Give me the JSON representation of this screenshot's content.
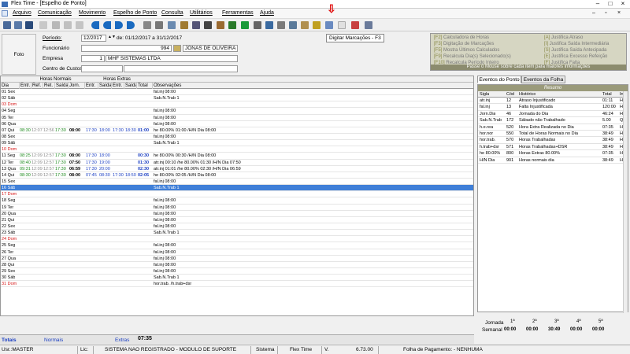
{
  "window": {
    "title": "Flex Time - [Espelho de Ponto]"
  },
  "menu": [
    "Arquivo",
    "Comunicação",
    "Movimento",
    "Espelho de Ponto",
    "Consulta",
    "Utilitários",
    "Ferramentas",
    "Ajuda"
  ],
  "tooltip": "Digitar Marcações - F3",
  "header": {
    "foto": "Foto",
    "periodo_label": "Período:",
    "periodo_value": "12/2017",
    "periodo_range": "de: 01/12/2017 a 31/12/2017",
    "funcionario_label": "Funcionário",
    "funcionario_id": "994",
    "funcionario_name": "JONAS DE OLIVEIRA",
    "empresa_label": "Empresa",
    "empresa_id": "1",
    "empresa_name": "MHF SISTEMAS LTDA",
    "centro_label": "Centro de Custos"
  },
  "legend": {
    "left": [
      {
        "k": "[F2]",
        "t": "Calculadora de Horas"
      },
      {
        "k": "[F3]",
        "t": "Digitação de Marcações"
      },
      {
        "k": "[F5]",
        "t": "Mostra Últimos Calculados"
      },
      {
        "k": "[F9]",
        "t": "Recalcula Dia(s) Selecionado(s)"
      },
      {
        "k": "[F10]",
        "t": "Recalcula Período Inteiro"
      }
    ],
    "right": [
      {
        "k": "[A]",
        "t": "Justifica Atraso"
      },
      {
        "k": "[I]",
        "t": "Justifica Saída Intermediária"
      },
      {
        "k": "[S]",
        "t": "Justifica Saída Antecipada"
      },
      {
        "k": "[E]",
        "t": "Justifica Excesso Refeição"
      },
      {
        "k": "[F]",
        "t": "Justifica Falta"
      }
    ],
    "note": "Passe o Mouse sobre cada item para maiores informações"
  },
  "grid": {
    "group_normais": "Horas Normais",
    "group_extras": "Horas Extras",
    "headers": [
      "Dia",
      "Entr.",
      "Ref.",
      "Ret.",
      "Saída",
      "Jorn.",
      "Entr.",
      "Saída",
      "Entr.",
      "Saída",
      "Total",
      "Observações"
    ],
    "rows": [
      {
        "dia": "01 Sex",
        "obs": "fal.inj 08:00"
      },
      {
        "dia": "02 Sáb",
        "obs": "Sab.N.Trab 1"
      },
      {
        "dia": "03 Dom",
        "red": true
      },
      {
        "dia": "04 Seg",
        "obs": "fal.inj 08:00"
      },
      {
        "dia": "05 Ter",
        "obs": "fal.inj 08:00"
      },
      {
        "dia": "06 Qua",
        "obs": "fal.inj 08:00"
      },
      {
        "dia": "07 Qui",
        "e1": "08:30",
        "r1": "12:07",
        "r2": "12:56",
        "s1": "17:30",
        "jor": "08:00",
        "xe1": "17:30",
        "xs1": "18:00",
        "xe2": "17:30",
        "xs2": "18:30",
        "tot": "01:00",
        "obs": "he 80.00% 01:00 /H/N Dia 08:00"
      },
      {
        "dia": "08 Sex",
        "obs": "fal.inj 08:00"
      },
      {
        "dia": "09 Sáb",
        "obs": "Sab.N.Trab 1"
      },
      {
        "dia": "10 Dom",
        "red": true
      },
      {
        "dia": "11 Seg",
        "e1": "08:25",
        "r1": "12:09",
        "r2": "12:57",
        "s1": "17:30",
        "jor": "08:00",
        "xe1": "17:30",
        "xs1": "18:00",
        "tot": "00:30",
        "obs": "he 80.00% 00:30 /H/N Dia 08:00"
      },
      {
        "dia": "12 Ter",
        "e1": "08:40",
        "r1": "12:09",
        "r2": "12:57",
        "s1": "17:30",
        "jor": "07:50",
        "xe1": "17:30",
        "xs1": "19:00",
        "tot": "01:30",
        "obs": "atr.inj 00:10 /he 80.00% 01:30 /H/N Dia 07:50"
      },
      {
        "dia": "13 Qua",
        "e1": "09:31",
        "r1": "12:09",
        "r2": "12:57",
        "s1": "17:30",
        "jor": "06:59",
        "xe1": "17:30",
        "xs1": "20:00",
        "tot": "02:30",
        "obs": "atr.inj 01:01 /he 80.00% 02:30 /H/N Dia 06:59"
      },
      {
        "dia": "14 Qui",
        "e1": "08:30",
        "r1": "12:09",
        "r2": "12:57",
        "s1": "17:30",
        "jor": "08:00",
        "xe1": "07:45",
        "xs1": "08:30",
        "xe2": "17:30",
        "xs2": "18:50",
        "tot": "02:05",
        "obs": "he 80.00% 02:05 /H/N Dia 08:00"
      },
      {
        "dia": "15 Sex",
        "obs": "fal.inj 08:00"
      },
      {
        "dia": "16 Sáb",
        "obs": "Sab.N.Trab 1",
        "sel": true
      },
      {
        "dia": "17 Dom",
        "red": true
      },
      {
        "dia": "18 Seg",
        "obs": "fal.inj 08:00"
      },
      {
        "dia": "19 Ter",
        "obs": "fal.inj 08:00"
      },
      {
        "dia": "20 Qua",
        "obs": "fal.inj 08:00"
      },
      {
        "dia": "21 Qui",
        "obs": "fal.inj 08:00"
      },
      {
        "dia": "22 Sex",
        "obs": "fal.inj 08:00"
      },
      {
        "dia": "23 Sáb",
        "obs": "Sab.N.Trab 1"
      },
      {
        "dia": "24 Dom",
        "red": true
      },
      {
        "dia": "25 Seg",
        "obs": "fal.inj 08:00"
      },
      {
        "dia": "26 Ter",
        "obs": "fal.inj 08:00"
      },
      {
        "dia": "27 Qua",
        "obs": "fal.inj 08:00"
      },
      {
        "dia": "28 Qui",
        "obs": "fal.inj 08:00"
      },
      {
        "dia": "29 Sex",
        "obs": "fal.inj 08:00"
      },
      {
        "dia": "30 Sáb",
        "obs": "Sab.N.Trab 1"
      },
      {
        "dia": "31 Dom",
        "red": true,
        "obs": "hor.trab. /h.trab+dsr"
      }
    ]
  },
  "rpanel": {
    "tabs": [
      "Eventos do Ponto",
      "Eventos da Folha"
    ],
    "title": "Resumo",
    "headers": [
      "Sigla",
      "Cód",
      "Histórico",
      "Total",
      "In"
    ],
    "rows": [
      {
        "s": "atr.inj",
        "c": "12",
        "h": "Atraso Injustificado",
        "t": "01:11",
        "i": "H"
      },
      {
        "s": "fal.inj",
        "c": "13",
        "h": "Falta Injustificada",
        "t": "120:00",
        "i": "H"
      },
      {
        "s": "Jorn.Dia",
        "c": "46",
        "h": "Jornada do Dia",
        "t": "46:24",
        "i": "H"
      },
      {
        "s": "Sab.N.Trab",
        "c": "172",
        "h": "Sábado não Trabalhado",
        "t": "5.00",
        "i": "Q"
      },
      {
        "s": "h.e.rea",
        "c": "520",
        "h": "Hora Extra Realizada no Dia",
        "t": "07:35",
        "i": "H"
      },
      {
        "s": "hor.nor",
        "c": "550",
        "h": "Total de Horas Normais no Dia",
        "t": "38:49",
        "i": "H"
      },
      {
        "s": "hor.trab.",
        "c": "570",
        "h": "Horas Trabalhadas",
        "t": "38:49",
        "i": "H"
      },
      {
        "s": "h.trab+dsr",
        "c": "571",
        "h": "Horas Trabalhadas+DSR",
        "t": "38:49",
        "i": "H"
      },
      {
        "s": "he 80.00%",
        "c": "800",
        "h": "Horas Extras 80.00%",
        "t": "07:35",
        "i": "H"
      },
      {
        "s": "H/N Dia",
        "c": "901",
        "h": "Horas normais dia",
        "t": "38:49",
        "i": "H"
      }
    ]
  },
  "jornada": {
    "label1": "Jornada",
    "label2": "Semanal",
    "cols": [
      "1ª",
      "2ª",
      "3ª",
      "4ª",
      "5ª"
    ],
    "vals": [
      "00:00",
      "00:00",
      "30:49",
      "00:00",
      "00:00"
    ]
  },
  "totals": {
    "label": "Totais",
    "normais_label": "Normais",
    "extras_label": "Extras",
    "extras_value": "07:35"
  },
  "status": {
    "usr": "Usr.:MASTER",
    "lic": "Lic:",
    "reg": "SISTEMA NAO REGISTRADO - MODULO DE SUPORTE",
    "sistema": "Sistema",
    "app": "Flex Time",
    "v": "V.",
    "versao": "6.73.00",
    "folha": "Folha de Pagamento: - NENHUMA"
  }
}
